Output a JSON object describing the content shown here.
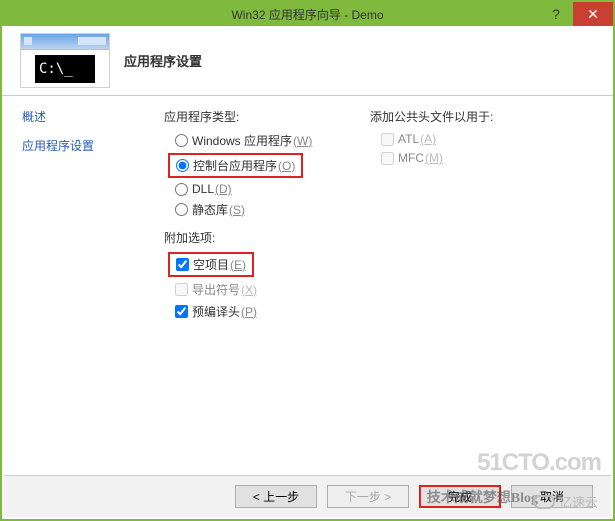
{
  "title": "Win32 应用程序向导 - Demo",
  "header_title": "应用程序设置",
  "terminal_text": "C:\\_",
  "nav": {
    "overview": "概述",
    "settings": "应用程序设置"
  },
  "left_column": {
    "app_type_label": "应用程序类型:",
    "windows_app": "Windows 应用程序",
    "windows_app_key": "(W)",
    "console_app": "控制台应用程序",
    "console_app_key": "(O)",
    "dll": "DLL",
    "dll_key": "(D)",
    "static_lib": "静态库",
    "static_lib_key": "(S)",
    "attach_label": "附加选项:",
    "empty_project": "空项目",
    "empty_project_key": "(E)",
    "export_symbols": "导出符号",
    "export_symbols_key": "(X)",
    "precompiled": "预编译头",
    "precompiled_key": "(P)"
  },
  "right_column": {
    "public_headers_label": "添加公共头文件以用于:",
    "atl": "ATL",
    "atl_key": "(A)",
    "mfc": "MFC",
    "mfc_key": "(M)"
  },
  "footer": {
    "prev": "< 上一步",
    "next": "下一步 >",
    "finish": "完成",
    "cancel": "取消"
  },
  "watermarks": {
    "w1": "51CTO.com",
    "w2": "亿速云",
    "w3": "技术成就梦想Blog"
  }
}
